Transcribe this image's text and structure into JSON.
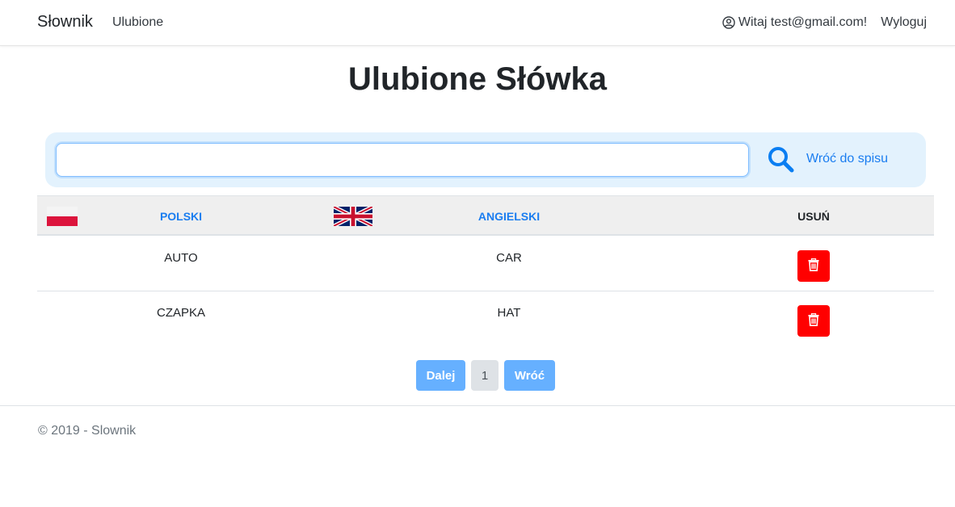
{
  "navbar": {
    "brand": "Słownik",
    "favorites_link": "Ulubione",
    "greeting": "Witaj test@gmail.com!",
    "logout": "Wyloguj"
  },
  "page": {
    "title": "Ulubione Słówka"
  },
  "search": {
    "value": "",
    "placeholder": "",
    "back_link": "Wróć do spisu"
  },
  "table": {
    "headers": {
      "polish": "POLSKI",
      "english": "ANGIELSKI",
      "delete": "USUŃ"
    },
    "rows": [
      {
        "polish": "AUTO",
        "english": "CAR"
      },
      {
        "polish": "CZAPKA",
        "english": "HAT"
      }
    ]
  },
  "pagination": {
    "next": "Dalej",
    "page": "1",
    "prev": "Wróć"
  },
  "footer": {
    "text": "© 2019 - Slownik"
  },
  "colors": {
    "accent": "#1a7df0",
    "delete": "#ff0000",
    "search_panel": "#e3f2fd"
  },
  "icons": {
    "user": "user-circle-icon",
    "search": "search-icon",
    "delete": "trash-icon",
    "flag_polish": "polish-flag-icon",
    "flag_english": "uk-flag-icon"
  }
}
